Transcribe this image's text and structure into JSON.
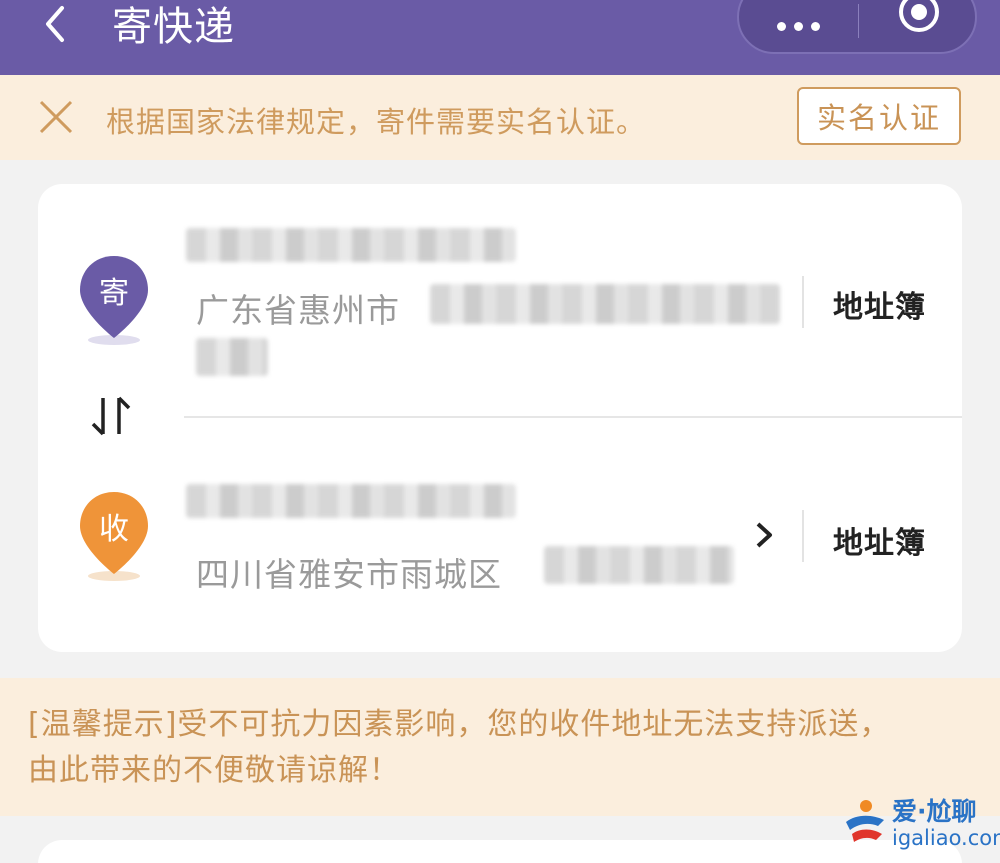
{
  "header": {
    "title": "寄快递",
    "back_icon": "chevron-left-icon",
    "more_icon": "more-dots-icon",
    "target_icon": "target-circle-icon",
    "background_color": "#6a5ba6"
  },
  "notice": {
    "text": "根据国家法律规定，寄件需要实名认证。",
    "button_label": "实名认证",
    "close_icon": "close-icon",
    "accent_color": "#cf9b5e"
  },
  "sender": {
    "badge": "寄",
    "badge_color": "#6a5ba6",
    "address": "广东省惠州市",
    "address_book_label": "地址簿"
  },
  "swap_icon": "swap-arrows-icon",
  "receiver": {
    "badge": "收",
    "badge_color": "#ef9439",
    "address": "四川省雅安市雨城区",
    "address_book_label": "地址簿",
    "chevron_icon": "chevron-right-icon"
  },
  "tip": {
    "line1": "[温馨提示]受不可抗力因素影响，您的收件地址无法支持派送，",
    "line2": "由此带来的不便敬请谅解！"
  },
  "watermark": {
    "top": "爱·尬聊",
    "bottom": "igaliao.com"
  }
}
